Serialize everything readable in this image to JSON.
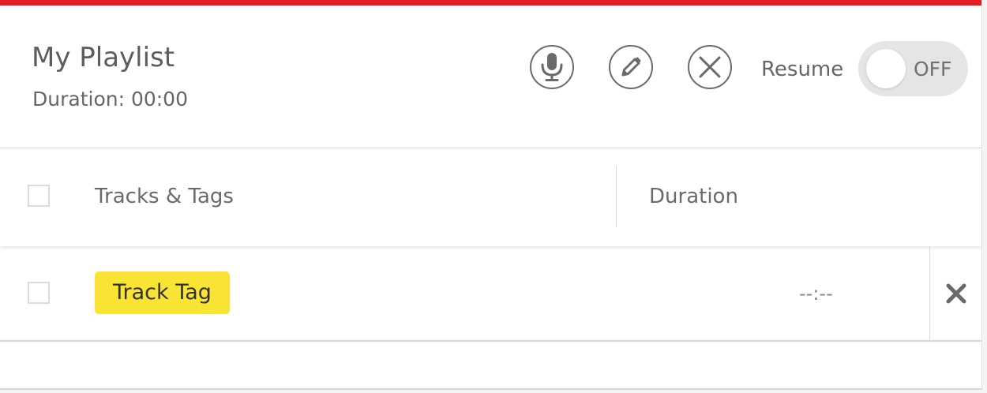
{
  "colors": {
    "accent": "#e31e24",
    "tag_background": "#fae433",
    "toggle_background": "#e5e5e5",
    "icon": "#6a6a6a"
  },
  "header": {
    "title": "My Playlist",
    "duration": "Duration: 00:00",
    "actions": [
      {
        "name": "microphone",
        "icon": "microphone-icon"
      },
      {
        "name": "edit",
        "icon": "pencil-icon"
      },
      {
        "name": "close",
        "icon": "close-circle-icon"
      }
    ],
    "resume": {
      "label": "Resume",
      "state": "OFF"
    }
  },
  "table": {
    "columns": [
      "Tracks & Tags",
      "Duration"
    ],
    "rows": [
      {
        "tag": "Track Tag",
        "duration": "--:--",
        "remove_icon": "x-icon"
      }
    ]
  }
}
